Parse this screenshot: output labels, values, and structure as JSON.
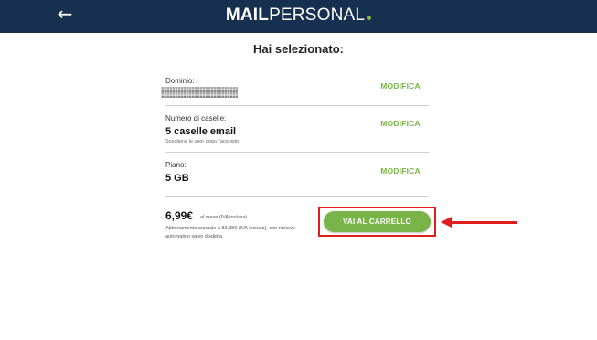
{
  "header": {
    "back_icon": "arrow-left-icon",
    "logo_bold": "MAIL",
    "logo_light": "PERSONAL",
    "background_color": "#17304f"
  },
  "main": {
    "title": "Hai selezionato:",
    "sections": {
      "domain": {
        "label": "Dominio:",
        "edit_label": "MODIFICA"
      },
      "mailboxes": {
        "label": "Numero di caselle:",
        "value": "5 caselle email",
        "note": "Sceglierai le user dopo l'acquisto",
        "edit_label": "MODIFICA"
      },
      "plan": {
        "label": "Piano:",
        "value": "5 GB",
        "edit_label": "MODIFICA"
      }
    },
    "summary": {
      "price": "6,99€",
      "price_suffix": "al mese (IVA inclusa)",
      "terms": "Abbonamento annuale a 83,88€ (IVA inclusa), con rinnovo automatico salvo disdetta.",
      "cart_button_label": "VAI AL CARRELLO"
    }
  },
  "colors": {
    "accent_green": "#79b448",
    "highlight_red": "#e01e1e"
  }
}
